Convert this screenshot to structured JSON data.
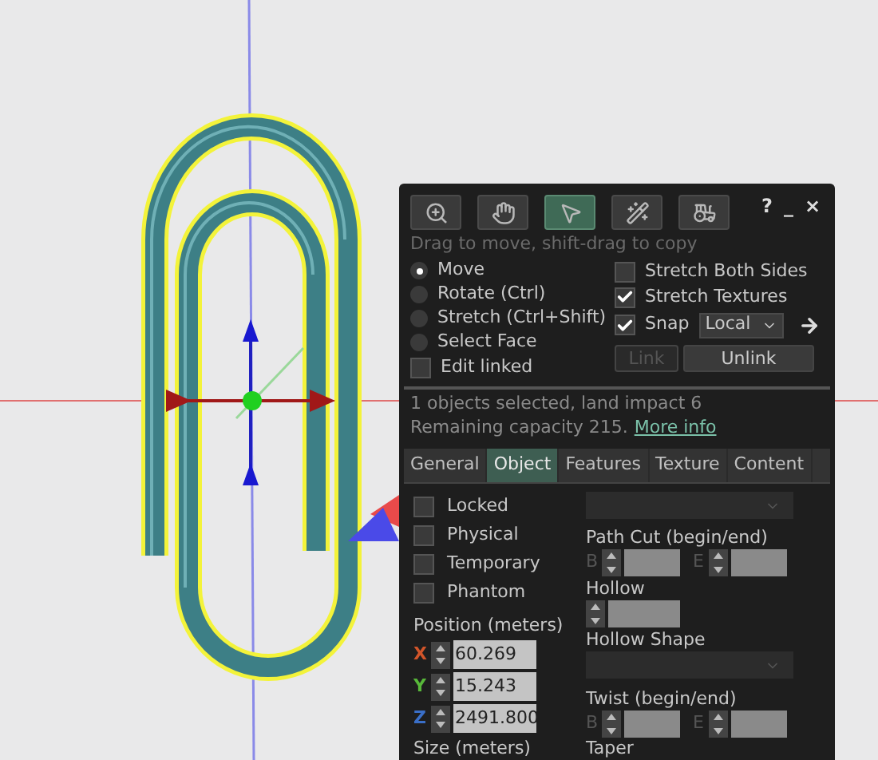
{
  "tools": [
    {
      "kind": "zoom",
      "selected": false
    },
    {
      "kind": "grab",
      "selected": false
    },
    {
      "kind": "move",
      "selected": true
    },
    {
      "kind": "create",
      "selected": false
    },
    {
      "kind": "land",
      "selected": false
    }
  ],
  "window_controls": [
    "?",
    "_",
    "×"
  ],
  "hint": "Drag to move, shift-drag to copy",
  "modes": [
    {
      "label": "Move",
      "selected": true
    },
    {
      "label": "Rotate (Ctrl)",
      "selected": false
    },
    {
      "label": "Stretch (Ctrl+Shift)",
      "selected": false
    },
    {
      "label": "Select Face",
      "selected": false
    }
  ],
  "edit_linked": {
    "label": "Edit linked",
    "checked": false
  },
  "options": [
    {
      "label": "Stretch Both Sides",
      "checked": false
    },
    {
      "label": "Stretch Textures",
      "checked": true
    }
  ],
  "snap": {
    "label": "Snap",
    "checked": true,
    "value": "Local"
  },
  "link_buttons": [
    {
      "label": "Link",
      "disabled": true
    },
    {
      "label": "Unlink",
      "disabled": false
    }
  ],
  "status": "1 objects selected, land impact 6",
  "capacity": {
    "text": "Remaining capacity 215.",
    "link": "More info"
  },
  "tabs": [
    {
      "label": "General",
      "selected": false
    },
    {
      "label": "Object",
      "selected": true
    },
    {
      "label": "Features",
      "selected": false
    },
    {
      "label": "Texture",
      "selected": false
    },
    {
      "label": "Content",
      "selected": false
    }
  ],
  "flags": [
    {
      "label": "Locked",
      "checked": false
    },
    {
      "label": "Physical",
      "checked": false
    },
    {
      "label": "Temporary",
      "checked": false
    },
    {
      "label": "Phantom",
      "checked": false
    }
  ],
  "position": {
    "label": "Position (meters)",
    "axes": [
      {
        "axis": "X",
        "value": "60.269",
        "color": "#d2552a"
      },
      {
        "axis": "Y",
        "value": "15.243",
        "color": "#58b83a"
      },
      {
        "axis": "Z",
        "value": "2491.800",
        "color": "#3a6fc8"
      }
    ]
  },
  "size_label": "Size (meters)",
  "path_cut": {
    "label": "Path Cut (begin/end)",
    "begin": "B",
    "end": "E"
  },
  "hollow": {
    "label": "Hollow"
  },
  "hollow_shape": {
    "label": "Hollow Shape"
  },
  "twist": {
    "label": "Twist (begin/end)",
    "begin": "B",
    "end": "E"
  },
  "taper_label": "Taper"
}
